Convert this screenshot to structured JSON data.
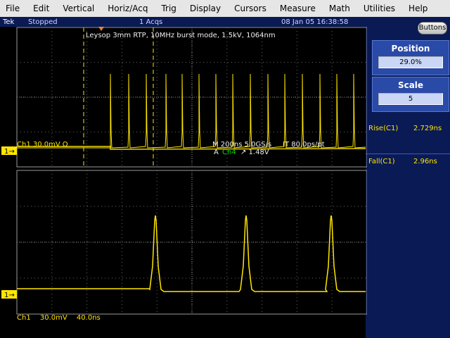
{
  "menu": [
    "File",
    "Edit",
    "Vertical",
    "Horiz/Acq",
    "Trig",
    "Display",
    "Cursors",
    "Measure",
    "Math",
    "Utilities",
    "Help"
  ],
  "status": {
    "brand": "Tek",
    "state": "Stopped",
    "acqs": "1 Acqs",
    "datetime": "08 Jan 05 16:38:58"
  },
  "buttons_label": "Buttons",
  "position": {
    "title": "Position",
    "value": "29.0%"
  },
  "scale": {
    "title": "Scale",
    "value": "5"
  },
  "measurements": [
    {
      "label": "Rise(C1)",
      "value": "2.729ns"
    },
    {
      "label": "Fall(C1)",
      "value": "2.96ns"
    }
  ],
  "overview_title": "Leysop 3mm RTP, 10MHz burst mode, 1.5kV, 1064nm",
  "overlay": {
    "ch_scale": "Ch1    30.0mV  Ω",
    "timebase": "M 200ns 5.0GS/s",
    "resolution": "IT 80.0ps/pt",
    "trig_a": "A",
    "trig_src": "Ch4",
    "trig_level": "↗  1.48V"
  },
  "bottom": {
    "ch": "Ch1",
    "volts": "30.0mV",
    "time": "40.0ns"
  },
  "ch_marker": "1",
  "colors": {
    "trace": "#ffe600",
    "accent": "#ff7a1a",
    "bg": "#0a1a55",
    "ch4": "#00e000"
  }
}
